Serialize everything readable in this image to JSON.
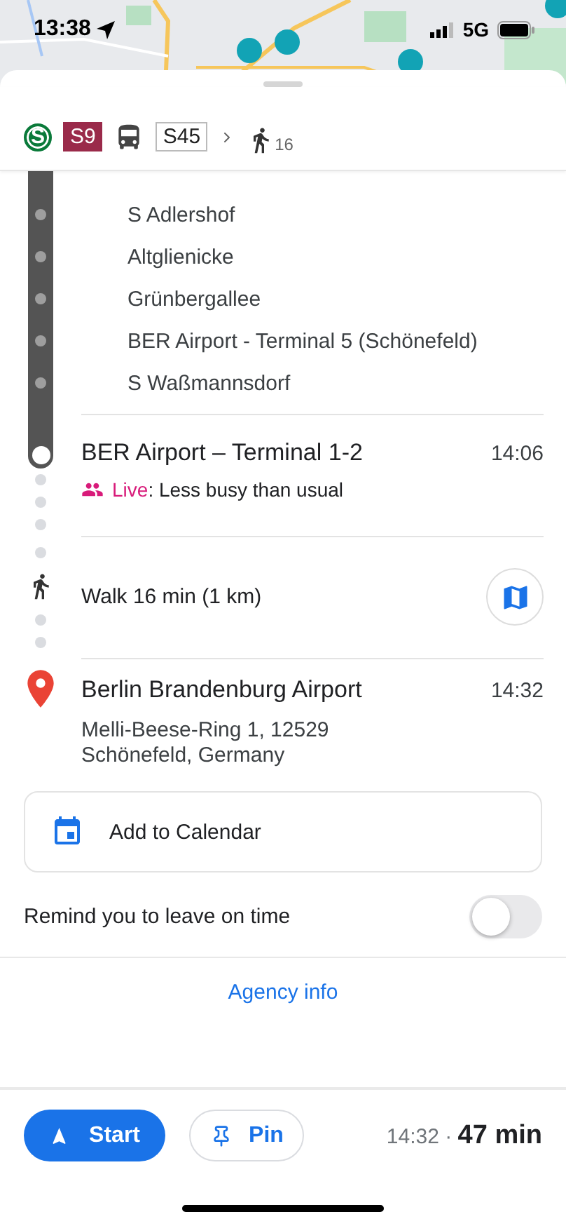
{
  "status_bar": {
    "time": "13:38",
    "network": "5G"
  },
  "route_summary": {
    "steps": [
      {
        "kind": "logo",
        "label": "S"
      },
      {
        "kind": "filled",
        "label": "S9"
      },
      {
        "kind": "bus"
      },
      {
        "kind": "outlined",
        "label": "S45"
      },
      {
        "kind": "walk",
        "label": "16"
      }
    ]
  },
  "stops": [
    "S Adlershof",
    "Altglienicke",
    "Grünbergallee",
    "BER Airport - Terminal 5 (Schönefeld)",
    "S Waßmannsdorf"
  ],
  "arrival": {
    "name": "BER Airport – Terminal 1-2",
    "time": "14:06",
    "live_label": "Live",
    "live_text": ": Less busy than usual"
  },
  "walk": {
    "text": "Walk 16 min (1 km)"
  },
  "destination": {
    "name": "Berlin Brandenburg Airport",
    "time": "14:32",
    "address_lines": [
      "Melli-Beese-Ring 1, 12529",
      "Schönefeld, Germany"
    ]
  },
  "calendar_button": "Add to Calendar",
  "reminder": {
    "label": "Remind you to leave on time",
    "on": false
  },
  "agency_link": "Agency info",
  "footer": {
    "start": "Start",
    "pin": "Pin",
    "arrival_time": "14:32",
    "separator": "·",
    "duration": "47 min"
  }
}
